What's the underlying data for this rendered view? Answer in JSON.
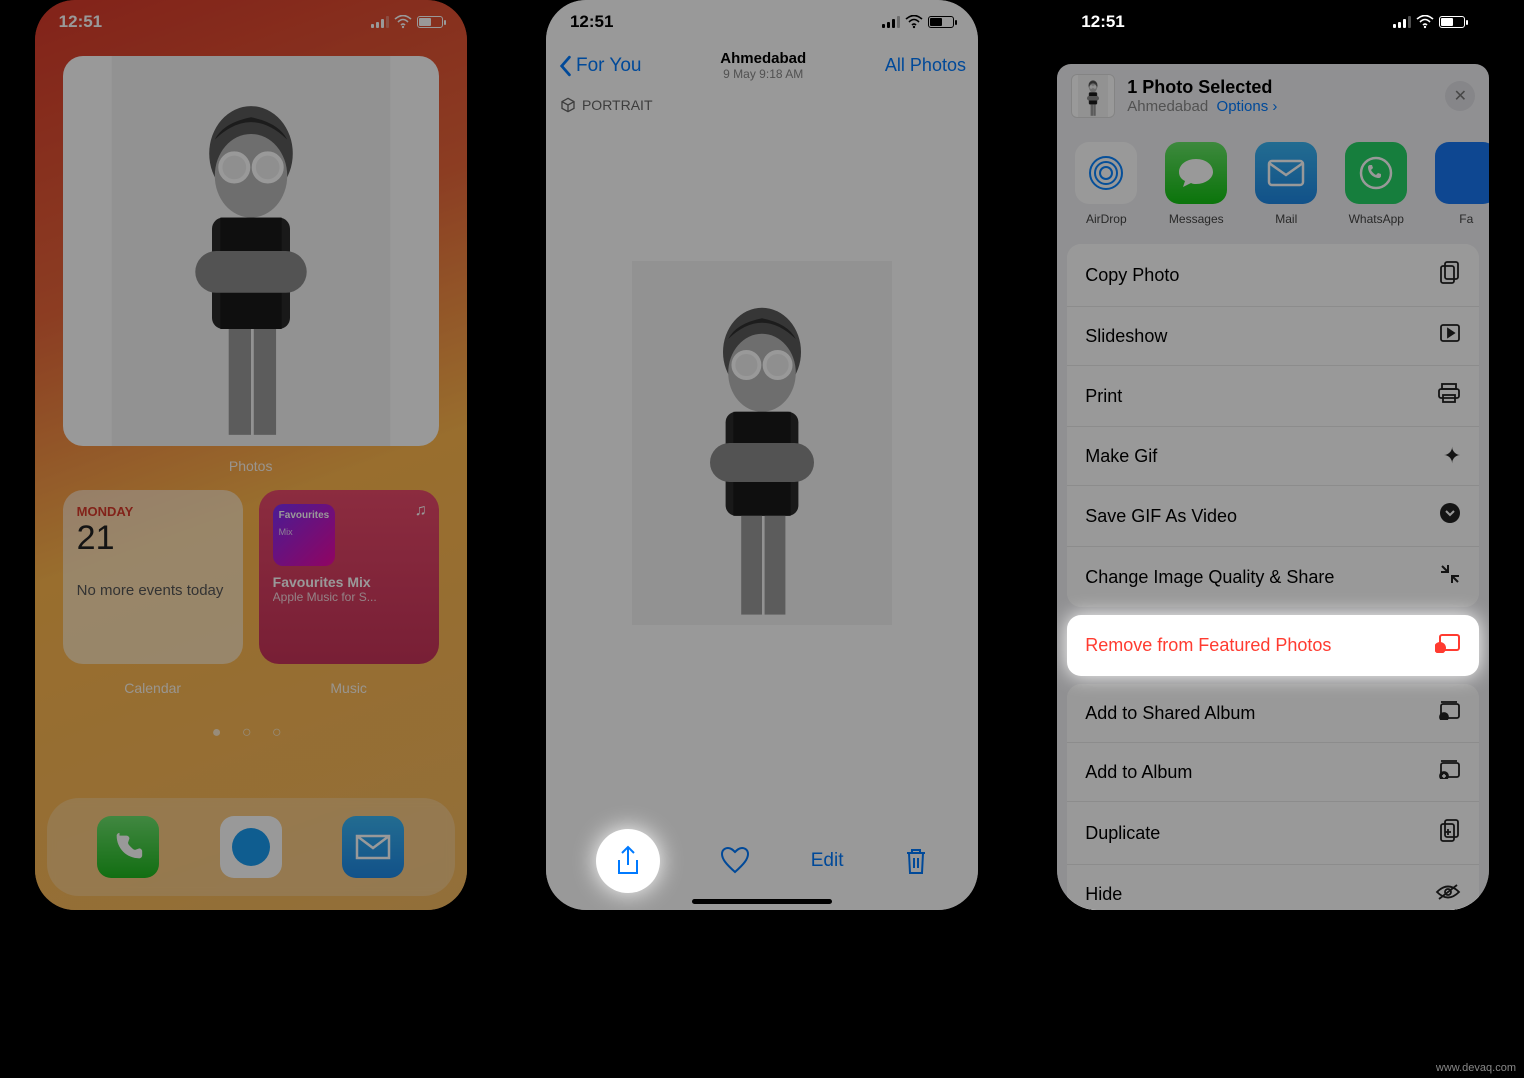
{
  "status": {
    "time": "12:51"
  },
  "phone1": {
    "photos_label": "Photos",
    "calendar": {
      "day": "MONDAY",
      "date": "21",
      "events": "No more events today",
      "label": "Calendar"
    },
    "music": {
      "badge": "Favourites",
      "badge_sub": "Mix",
      "title": "Favourites Mix",
      "subtitle": "Apple Music for S...",
      "label": "Music"
    }
  },
  "phone2": {
    "back": "For You",
    "location": "Ahmedabad",
    "date": "9 May  9:18 AM",
    "all_photos": "All Photos",
    "portrait": "PORTRAIT",
    "edit": "Edit"
  },
  "phone3": {
    "title": "1 Photo Selected",
    "sub_location": "Ahmedabad",
    "options": "Options",
    "apps": [
      "AirDrop",
      "Messages",
      "Mail",
      "WhatsApp",
      "Fa"
    ],
    "actions1": [
      "Copy Photo",
      "Slideshow",
      "Print",
      "Make Gif",
      "Save GIF As Video",
      "Change Image Quality & Share"
    ],
    "highlight": "Remove from Featured Photos",
    "actions2": [
      "Add to Shared Album",
      "Add to Album",
      "Duplicate",
      "Hide"
    ]
  },
  "watermark": "www.devaq.com"
}
